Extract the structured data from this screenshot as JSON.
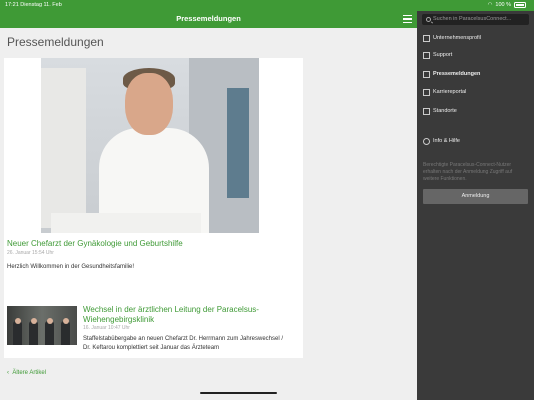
{
  "status": {
    "time": "17:21",
    "date": "Dienstag 11. Feb",
    "battery": "100 %"
  },
  "header": {
    "title": "Pressemeldungen"
  },
  "main": {
    "page_title": "Pressemeldungen",
    "articles": [
      {
        "title": "Neuer Chefarzt der Gynäkologie und Geburtshilfe",
        "date": "26. Januar 15:54 Uhr",
        "teaser": "Herzlich Willkommen in der Gesundheitsfamilie!"
      },
      {
        "title_line1": "Wechsel in der ärztlichen Leitung der Paracelsus-",
        "title_line2": "Wiehengebirgsklinik",
        "date": "16. Januar 10:47 Uhr",
        "teaser_line1": "Staffelstabübergabe an neuen Chefarzt Dr. Herrmann zum Jahreswechsel /",
        "teaser_line2": "Dr. Keftarou komplettiert seit Januar das Ärzteteam"
      }
    ],
    "older_label": "Ältere Artikel"
  },
  "sidebar": {
    "search_placeholder": "Suchen in ParacelsusConnect...",
    "items": [
      {
        "label": "Unternehmensprofil",
        "icon": "building-icon"
      },
      {
        "label": "Support",
        "icon": "folder-icon"
      },
      {
        "label": "Pressemeldungen",
        "icon": "news-icon",
        "active": true
      },
      {
        "label": "Karriereportal",
        "icon": "briefcase-icon"
      },
      {
        "label": "Standorte",
        "icon": "location-icon"
      },
      {
        "label": "Info & Hilfe",
        "icon": "info-icon"
      }
    ],
    "login_note_line1": "Berechtigte Paracelsus-Connect-Nutzer",
    "login_note_line2": "erhalten nach der Anmeldung Zugriff auf",
    "login_note_line3": "weitere Funktionen.",
    "login_button": "Anmeldung"
  },
  "colors": {
    "brand": "#3f9a36",
    "sidebar": "#3a3a3a"
  }
}
